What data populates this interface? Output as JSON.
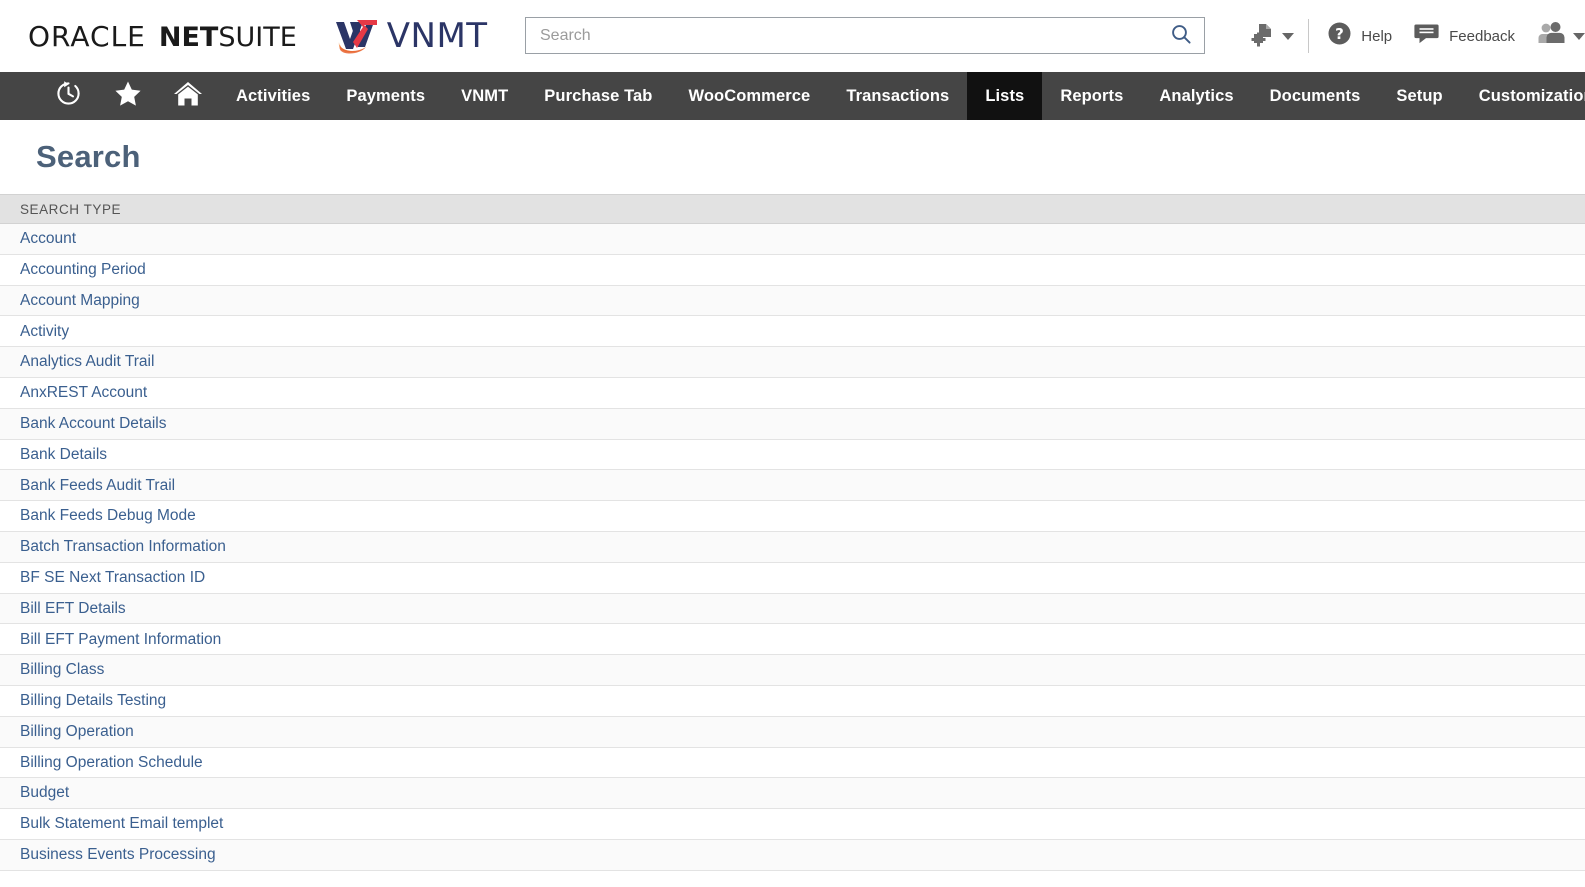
{
  "header": {
    "brand": {
      "oracle_word": "ORACLE",
      "netsuite_bold": "NET",
      "netsuite_light": "SUITE",
      "partner_logo_name": "VNMT",
      "partner_word": "VNMT"
    },
    "search": {
      "placeholder": "Search",
      "value": "",
      "icon": "search-icon"
    },
    "actions": [
      {
        "name": "create-new",
        "icon": "new-document-plus-icon",
        "label": "",
        "has_caret": true
      },
      {
        "name": "help",
        "icon": "question-circle-icon",
        "label": "Help",
        "has_caret": false
      },
      {
        "name": "feedback",
        "icon": "speech-bubble-icon",
        "label": "Feedback",
        "has_caret": false
      },
      {
        "name": "user-switcher",
        "icon": "users-icon",
        "label": "",
        "has_caret": true
      }
    ]
  },
  "nav": {
    "icons": [
      {
        "name": "recent-history",
        "icon": "clock-back-arrow-icon"
      },
      {
        "name": "shortcuts",
        "icon": "star-icon"
      },
      {
        "name": "home",
        "icon": "home-icon"
      }
    ],
    "items": [
      {
        "label": "Activities",
        "active": false
      },
      {
        "label": "Payments",
        "active": false
      },
      {
        "label": "VNMT",
        "active": false
      },
      {
        "label": "Purchase Tab",
        "active": false
      },
      {
        "label": "WooCommerce",
        "active": false
      },
      {
        "label": "Transactions",
        "active": false
      },
      {
        "label": "Lists",
        "active": true
      },
      {
        "label": "Reports",
        "active": false
      },
      {
        "label": "Analytics",
        "active": false
      },
      {
        "label": "Documents",
        "active": false
      },
      {
        "label": "Setup",
        "active": false
      },
      {
        "label": "Customization",
        "active": false
      }
    ]
  },
  "page": {
    "title": "Search"
  },
  "table": {
    "column_header": "SEARCH TYPE",
    "rows": [
      "Account",
      "Accounting Period",
      "Account Mapping",
      "Activity",
      "Analytics Audit Trail",
      "AnxREST Account",
      "Bank Account Details",
      "Bank Details",
      "Bank Feeds Audit Trail",
      "Bank Feeds Debug Mode",
      "Batch Transaction Information",
      "BF SE Next Transaction ID",
      "Bill EFT Details",
      "Bill EFT Payment Information",
      "Billing Class",
      "Billing Details Testing",
      "Billing Operation",
      "Billing Operation Schedule",
      "Budget",
      "Bulk Statement Email templet",
      "Business Events Processing"
    ]
  },
  "colors": {
    "nav_bg": "#454545",
    "nav_active_bg": "#111111",
    "title_color": "#4c6179",
    "link_color": "#3a5f8f",
    "col_header_bg": "#e2e2e2",
    "partner_navy": "#2b3566",
    "partner_red": "#e63946",
    "partner_orange": "#f4a261"
  }
}
